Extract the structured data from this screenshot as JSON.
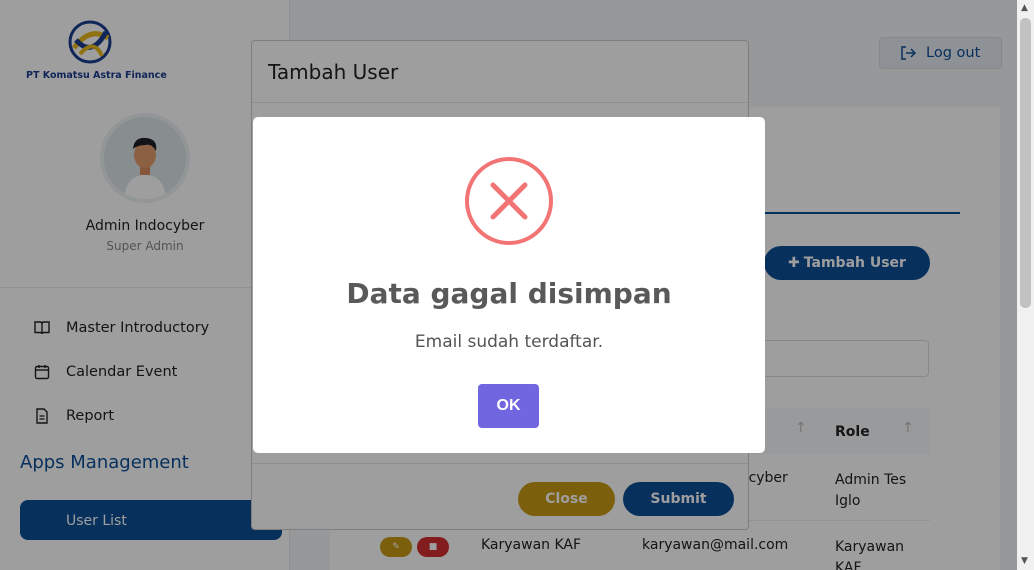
{
  "brand": {
    "company": "PT Komatsu Astra Finance"
  },
  "profile": {
    "name": "Admin Indocyber",
    "role": "Super Admin"
  },
  "sidebar": {
    "items": [
      {
        "label": "Master Introductory",
        "icon": "book-icon"
      },
      {
        "label": "Calendar Event",
        "icon": "calendar-icon"
      },
      {
        "label": "Report",
        "icon": "file-icon"
      }
    ],
    "section_title": "Apps Management",
    "active_item": {
      "label": "User List",
      "icon": "users-icon"
    }
  },
  "header": {
    "logout_label": "Log out"
  },
  "content": {
    "add_user_label": "Tambah User",
    "table": {
      "headers": [
        "Role"
      ],
      "rows": [
        {
          "name": "",
          "email": "ocyber",
          "role": "Admin Tes Iglo"
        },
        {
          "name": "Karyawan KAF",
          "email": "karyawan@mail.com",
          "role": "Karyawan KAF"
        }
      ]
    }
  },
  "modal": {
    "title": "Tambah User",
    "close_label": "Close",
    "submit_label": "Submit"
  },
  "alert": {
    "icon": "error-x-icon",
    "title": "Data gagal disimpan",
    "text": "Email sudah terdaftar.",
    "ok_label": "OK",
    "error_color": "#f27474",
    "button_color": "#7066e0"
  }
}
